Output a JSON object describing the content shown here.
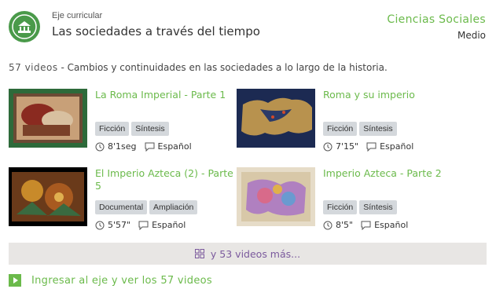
{
  "header": {
    "eyebrow": "Eje curricular",
    "title": "Las sociedades a través del tiempo",
    "area": "Ciencias Sociales",
    "level": "Medio"
  },
  "summary": {
    "count": "57 videos",
    "description": " - Cambios y continuidades en las sociedades a lo largo de la historia."
  },
  "videos": [
    {
      "title": "La Roma Imperial - Parte 1",
      "tags": [
        "Ficción",
        "Síntesis"
      ],
      "duration": "8'1seg",
      "language": "Español"
    },
    {
      "title": "Roma y su imperio",
      "tags": [
        "Ficción",
        "Síntesis"
      ],
      "duration": "7'15\"",
      "language": "Español"
    },
    {
      "title": "El Imperio Azteca (2) - Parte 5",
      "tags": [
        "Documental",
        "Ampliación"
      ],
      "duration": "5'57\"",
      "language": "Español"
    },
    {
      "title": "Imperio Azteca - Parte 2",
      "tags": [
        "Ficción",
        "Síntesis"
      ],
      "duration": "8'5\"",
      "language": "Español"
    }
  ],
  "more_label": "y 53 videos más...",
  "enter_label": "Ingresar al eje y ver los 57 videos",
  "colors": {
    "accent": "#6bba4b",
    "more_text": "#7b5a9d",
    "tag_bg": "#d4d8dc"
  }
}
